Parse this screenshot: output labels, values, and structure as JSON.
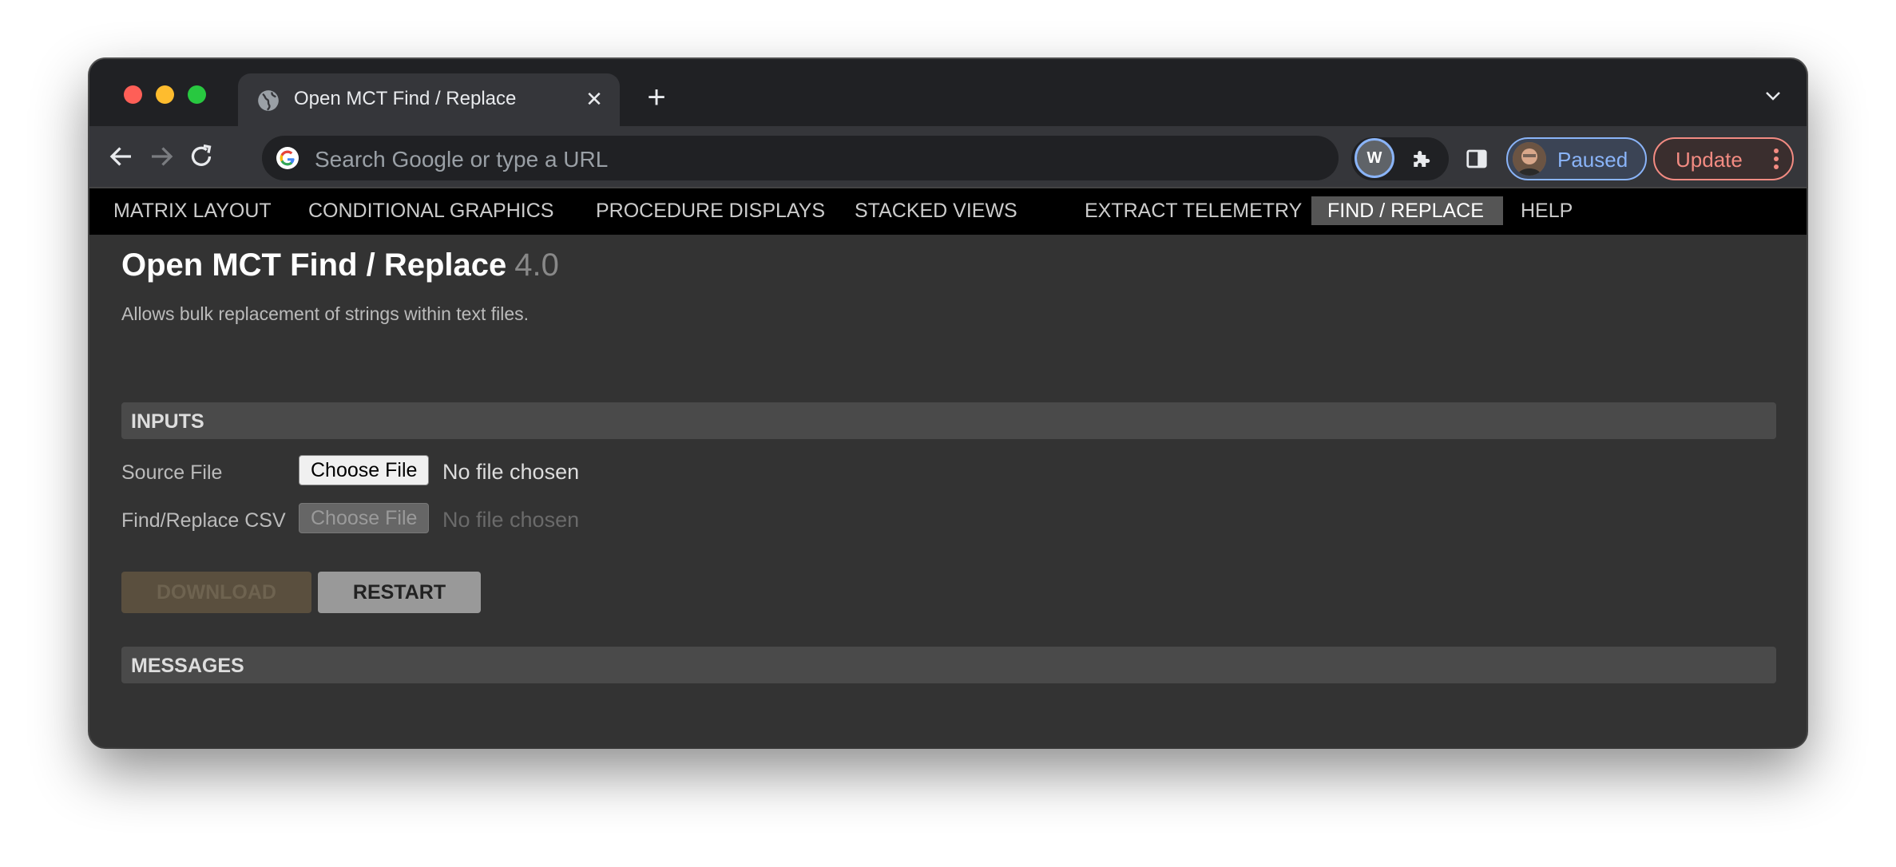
{
  "browser": {
    "tab_title": "Open MCT Find / Replace",
    "omnibox_placeholder": "Search Google or type a URL",
    "profile_label": "Paused",
    "update_label": "Update"
  },
  "nav": {
    "items": [
      {
        "label": "MATRIX LAYOUT"
      },
      {
        "label": "CONDITIONAL GRAPHICS"
      },
      {
        "label": "PROCEDURE DISPLAYS"
      },
      {
        "label": "STACKED VIEWS"
      },
      {
        "label": "EXTRACT TELEMETRY"
      },
      {
        "label": "FIND / REPLACE"
      },
      {
        "label": "HELP"
      }
    ],
    "active": "FIND / REPLACE"
  },
  "page": {
    "title": "Open MCT Find / Replace",
    "version": "4.0",
    "description": "Allows bulk replacement of strings within text files."
  },
  "inputs": {
    "header": "INPUTS",
    "source_label": "Source File",
    "source_button": "Choose File",
    "source_status": "No file chosen",
    "csv_label": "Find/Replace CSV",
    "csv_button": "Choose File",
    "csv_status": "No file chosen"
  },
  "actions": {
    "download_label": "DOWNLOAD",
    "restart_label": "RESTART"
  },
  "messages": {
    "header": "MESSAGES"
  },
  "colors": {
    "accent_blue": "#8ab4f8",
    "update_red": "#f28b82",
    "nav_active_bg": "#555555"
  }
}
